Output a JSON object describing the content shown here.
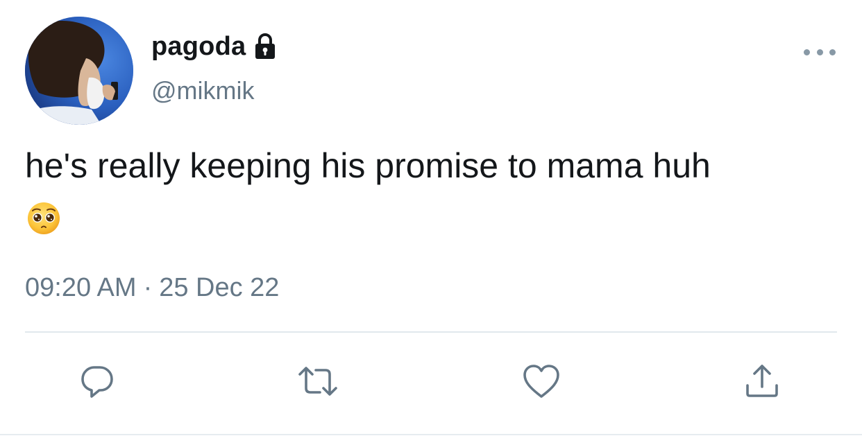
{
  "tweet": {
    "author": {
      "display_name": "pagoda",
      "handle": "@mikmik",
      "protected_icon": "lock-icon",
      "avatar": "avatar"
    },
    "text": "he's really keeping his promise to mama huh",
    "emoji": "pleading-face-emoji",
    "time": "09:20 AM",
    "separator": "·",
    "date": "25 Dec 22",
    "actions": {
      "reply_icon": "reply-icon",
      "retweet_icon": "retweet-icon",
      "like_icon": "like-icon",
      "share_icon": "share-icon"
    },
    "more_icon": "more-icon"
  },
  "colors": {
    "text_primary": "#14171a",
    "text_secondary": "#657786",
    "icon": "#657786",
    "divider": "#e1e8ed",
    "background": "#ffffff"
  }
}
